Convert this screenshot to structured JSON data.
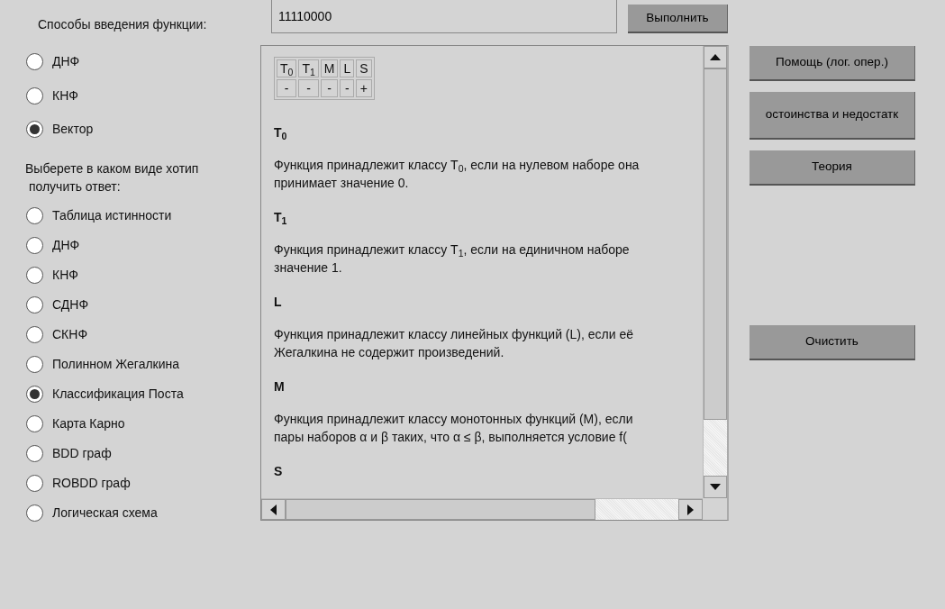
{
  "input_methods": {
    "title": "Способы введения функции:",
    "options": [
      {
        "label": "ДНФ",
        "selected": false
      },
      {
        "label": "КНФ",
        "selected": false
      },
      {
        "label": "Вектор",
        "selected": true
      }
    ]
  },
  "answer_forms": {
    "title_lines": [
      "Выберете в каком виде хотип",
      "получить ответ:"
    ],
    "options": [
      {
        "label": "Таблица истинности",
        "selected": false
      },
      {
        "label": "ДНФ",
        "selected": false
      },
      {
        "label": "КНФ",
        "selected": false
      },
      {
        "label": "СДНФ",
        "selected": false
      },
      {
        "label": "СКНФ",
        "selected": false
      },
      {
        "label": "Полинном Жегалкина",
        "selected": false
      },
      {
        "label": "Классификация Поста",
        "selected": true
      },
      {
        "label": "Карта Карно",
        "selected": false
      },
      {
        "label": "BDD граф",
        "selected": false
      },
      {
        "label": "ROBDD граф",
        "selected": false
      },
      {
        "label": "Логическая схема",
        "selected": false
      }
    ]
  },
  "vector_field": {
    "value": "11110000"
  },
  "run_button": "Выполнить",
  "result": {
    "table": {
      "columns": [
        "T$_{0}$",
        "T$_{1}$",
        "M",
        "L",
        "S"
      ],
      "values": [
        "-",
        "-",
        "-",
        "-",
        "+"
      ]
    },
    "sections": [
      {
        "heading": "T$_{0}$",
        "lines": [
          "Функция принадлежит классу T$_{0}$, если на нулевом наборе она",
          "принимает значение 0."
        ]
      },
      {
        "heading": "T$_{1}$",
        "lines": [
          "Функция принадлежит классу T$_{1}$, если на единичном наборе",
          "значение 1."
        ]
      },
      {
        "heading": "L",
        "lines": [
          "Функция принадлежит классу линейных функций (L), если её",
          "Жегалкина не содержит произведений."
        ]
      },
      {
        "heading": "M",
        "lines": [
          "Функция принадлежит классу монотонных функций (M), если",
          "пары наборов α и β таких, что α ≤ β, выполняется условие f("
        ]
      },
      {
        "heading": "S"
      }
    ]
  },
  "side_buttons": [
    "Помощь (лог. опер.)",
    "остоинства и недостатк",
    "Теория"
  ],
  "clear_button": "Очистить"
}
